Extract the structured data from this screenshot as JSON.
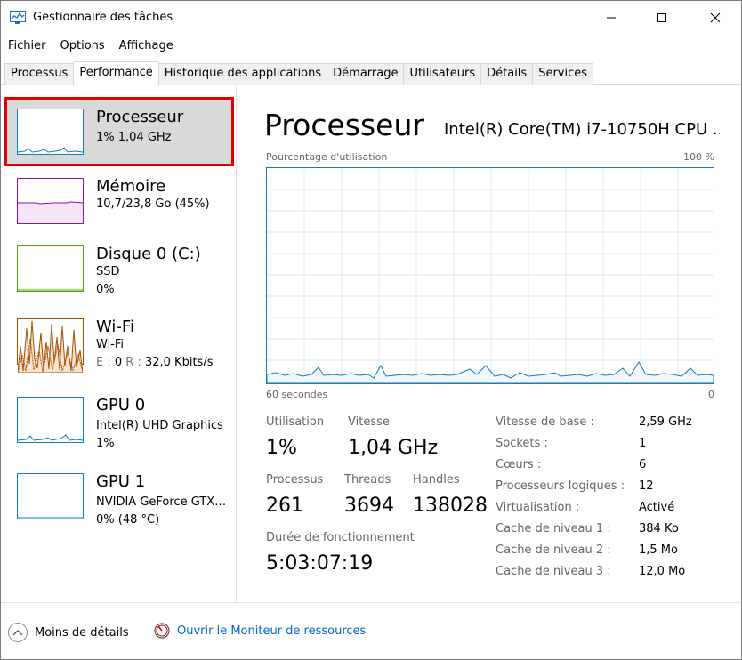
{
  "window": {
    "title": "Gestionnaire des tâches"
  },
  "menu": [
    "Fichier",
    "Options",
    "Affichage"
  ],
  "tabs": [
    {
      "label": "Processus",
      "active": false
    },
    {
      "label": "Performance",
      "active": true
    },
    {
      "label": "Historique des applications",
      "active": false
    },
    {
      "label": "Démarrage",
      "active": false
    },
    {
      "label": "Utilisateurs",
      "active": false
    },
    {
      "label": "Détails",
      "active": false
    },
    {
      "label": "Services",
      "active": false
    }
  ],
  "sidebar": {
    "items": [
      {
        "name": "Processeur",
        "line1": "1%  1,04 GHz",
        "line2": "",
        "color": "#117dbb"
      },
      {
        "name": "Mémoire",
        "line1": "10,7/23,8 Go (45%)",
        "line2": "",
        "color": "#8b12ae"
      },
      {
        "name": "Disque 0 (C:)",
        "line1": "SSD",
        "line2": "0%",
        "color": "#4da60c"
      },
      {
        "name": "Wi-Fi",
        "line1": "Wi-Fi",
        "line2_e_label": "E :",
        "line2_e_val": "0",
        "line2_r_label": "R :",
        "line2_r_val": "32,0 Kbits/s",
        "color": "#a74f01"
      },
      {
        "name": "GPU 0",
        "line1": "Intel(R) UHD Graphics",
        "line2": "1%",
        "color": "#117dbb"
      },
      {
        "name": "GPU 1",
        "line1": "NVIDIA GeForce GTX…",
        "line2": "0% (48 °C)",
        "color": "#117dbb"
      }
    ]
  },
  "main": {
    "title": "Processeur",
    "cpu_model": "Intel(R) Core(TM) i7-10750H CPU ...",
    "graph_top_left": "Pourcentage d'utilisation",
    "graph_top_right": "100 %",
    "graph_bottom_left": "60 secondes",
    "graph_bottom_right": "0",
    "stats": {
      "utilisation_label": "Utilisation",
      "utilisation_value": "1%",
      "vitesse_label": "Vitesse",
      "vitesse_value": "1,04 GHz",
      "processus_label": "Processus",
      "processus_value": "261",
      "threads_label": "Threads",
      "threads_value": "3694",
      "handles_label": "Handles",
      "handles_value": "138028",
      "uptime_label": "Durée de fonctionnement",
      "uptime_value": "5:03:07:19"
    },
    "details": [
      {
        "key": "Vitesse de base :",
        "value": "2,59 GHz"
      },
      {
        "key": "Sockets :",
        "value": "1"
      },
      {
        "key": "Cœurs :",
        "value": "6"
      },
      {
        "key": "Processeurs logiques :",
        "value": "12"
      },
      {
        "key": "Virtualisation :",
        "value": "Activé"
      },
      {
        "key": "Cache de niveau 1 :",
        "value": "384 Ko"
      },
      {
        "key": "Cache de niveau 2 :",
        "value": "1,5 Mo"
      },
      {
        "key": "Cache de niveau 3 :",
        "value": "12,0 Mo"
      }
    ]
  },
  "footer": {
    "less_details": "Moins de détails",
    "monitor_link": "Ouvrir le Moniteur de ressources"
  },
  "colors": {
    "cpu": "#117dbb",
    "memory": "#8b12ae",
    "disk": "#4da60c",
    "wifi": "#a74f01",
    "highlight": "#e00000",
    "link": "#0066cc"
  }
}
